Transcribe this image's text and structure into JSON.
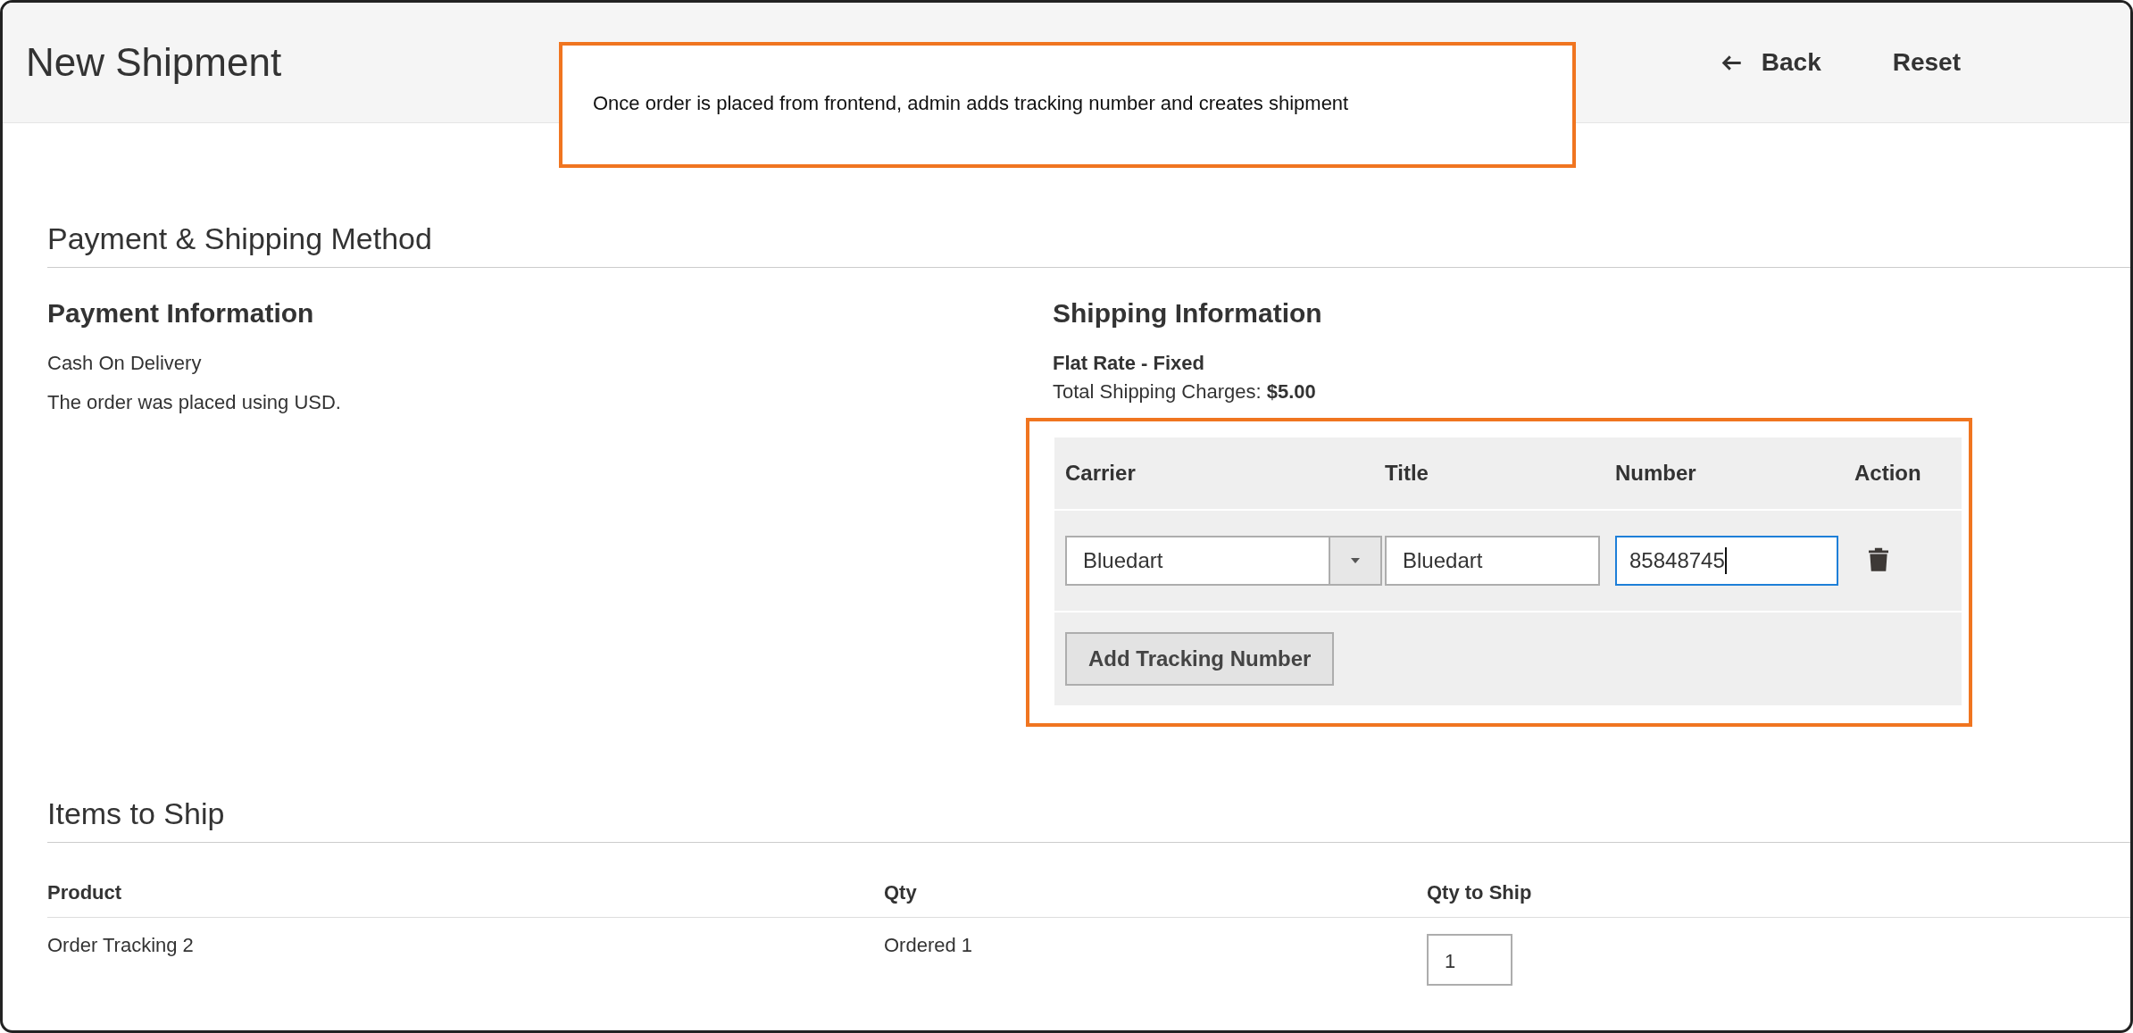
{
  "page_title": "New Shipment",
  "header_actions": [
    {
      "label": "Back",
      "kind": "back"
    },
    {
      "label": "Reset",
      "kind": "plain"
    }
  ],
  "annotations": [
    {
      "text": "Once order is placed from frontend, admin adds tracking number and creates shipment"
    }
  ],
  "payment_shipping": {
    "title": "Payment & Shipping Method",
    "payment": {
      "heading": "Payment Information",
      "lines": [
        "Cash On Delivery",
        "The order was placed using USD."
      ]
    },
    "shipping": {
      "heading": "Shipping Information",
      "method": "Flat Rate - Fixed",
      "charges_label": "Total Shipping Charges:",
      "charges_value": "$5.00",
      "tracking": {
        "highlighted": true,
        "columns": [
          "Carrier",
          "Title",
          "Number",
          "Action"
        ],
        "rows": [
          {
            "carrier": "Bluedart",
            "title": "Bluedart",
            "number": "85848745",
            "number_focused": true
          }
        ],
        "add_button": "Add Tracking Number"
      }
    }
  },
  "items_to_ship": {
    "title": "Items to Ship",
    "columns": [
      "Product",
      "Qty",
      "Qty to Ship"
    ],
    "rows": [
      {
        "product": "Order Tracking 2",
        "qty": "Ordered 1",
        "qty_to_ship": "1"
      }
    ]
  }
}
